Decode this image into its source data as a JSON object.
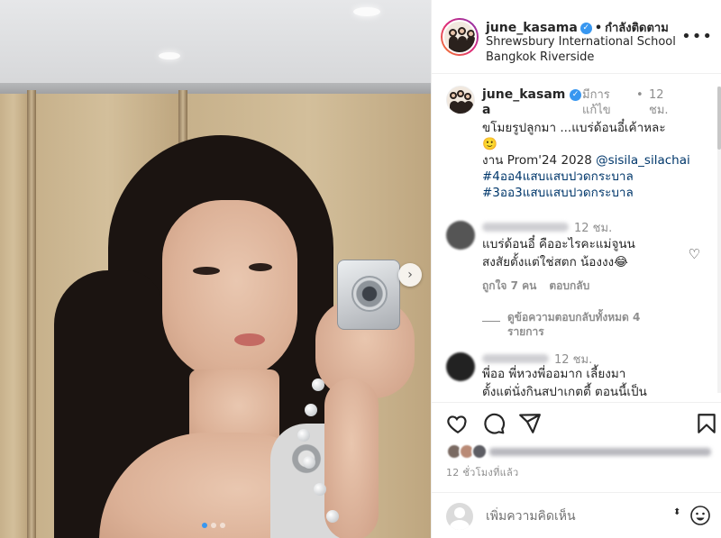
{
  "post": {
    "photo_alt": "",
    "carousel": {
      "slides": 3,
      "active_index": 0
    }
  },
  "header": {
    "username": "june_kasama",
    "separator": "•",
    "follow_label": "กำลังติดตาม",
    "location_line1": "Shrewsbury International School",
    "location_line2": "Bangkok Riverside",
    "more_label": "•••"
  },
  "caption": {
    "username_line1": "june_kasam",
    "username_line2": "a",
    "edited_line1": "มีการ",
    "edited_line2": "แก้ไข",
    "time_dot": "•",
    "time_line1": "12",
    "time_line2": "ชม.",
    "line1": "ขโมยรูปลูกมา ...แบร่ด้อนอี๋เค้าหละ",
    "emoji1": "🙂",
    "line2_prefix": "งาน Prom'24 2028 ",
    "mention": "@sisila_silachai",
    "tag1": "#4ออ4แสบแสบปวดกระบาล",
    "tag2": "#3ออ3แสบแสบปวดกระบาล"
  },
  "comments": [
    {
      "time": "12 ชม.",
      "text_line1": "แบร่ด้อนอี๋ คืออะไรคะแม่จูนน",
      "text_line2": "สงสัยตั้งแต่ใช่สตก น้องงง😂",
      "likes": "ถูกใจ 7 คน",
      "reply_label": "ตอบกลับ",
      "view_replies_line1": "ดูข้อความตอบกลับทั้งหมด 4",
      "view_replies_line2": "รายการ"
    },
    {
      "time": "12 ชม.",
      "text_line1": "พี่ออ พี่หวงพี่ออมาก เลี้ยงมา",
      "text_line2": "ตั้งแต่นั่งกินสปาเกตตี้ ตอนนี้เป็น"
    }
  ],
  "actions": {
    "like_icon": "heart-icon",
    "comment_icon": "comment-icon",
    "share_icon": "share-icon",
    "save_icon": "bookmark-icon"
  },
  "posted_ago": "12 ชั่วโมงที่แล้ว",
  "add_comment": {
    "placeholder": "เพิ่มความคิดเห็น",
    "sort_glyph": "⬍"
  },
  "colors": {
    "verified": "#3897f0",
    "link": "#00376b",
    "muted": "#8e8e8e",
    "text": "#262626"
  }
}
